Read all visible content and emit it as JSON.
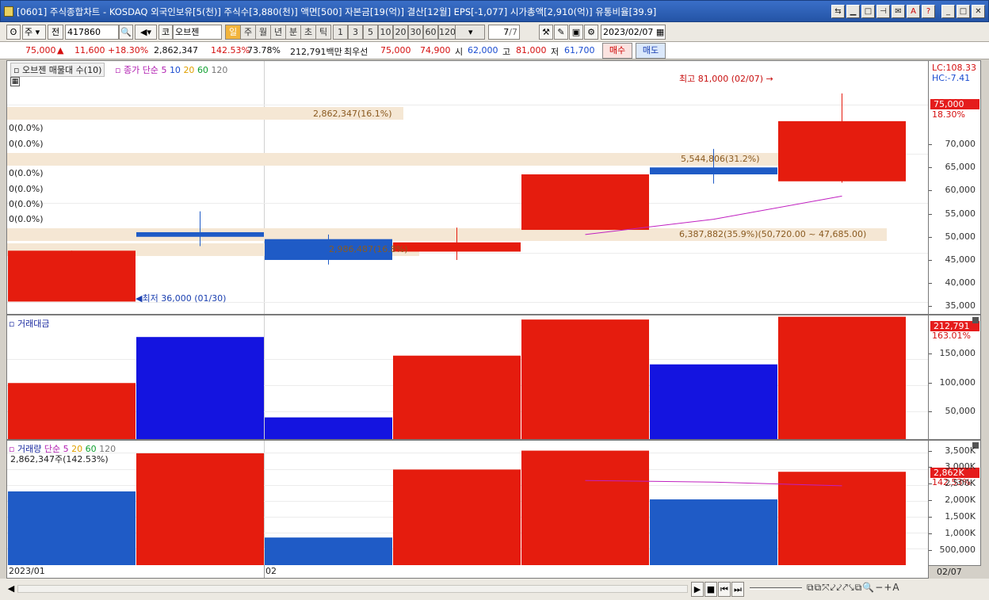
{
  "title": "[0601] 주식종합차트 - KOSDAQ 외국인보유[5(천)] 주식수[3,880(천)] 액면[500] 자본금[19(억)] 결산[12월] EPS[-1,077] 시가총액[2,910(억)] 유통비율[39.9]",
  "toolbar": {
    "period_type": "주",
    "prev_label": "전",
    "code": "417860",
    "market_tag": "코",
    "stock_name": "오브젠",
    "periods": [
      "일",
      "주",
      "월",
      "년",
      "분",
      "초",
      "틱"
    ],
    "active_period": "일",
    "intervals": [
      "1",
      "3",
      "5",
      "10",
      "20",
      "30",
      "60",
      "120"
    ],
    "count": "7",
    "count_total": "/7",
    "date": "2023/02/07"
  },
  "quote": {
    "price": "75,000",
    "up_arrow": "▲",
    "change": "11,600",
    "change_pct": "+18.30%",
    "volume": "2,862,347",
    "volume_ratio": "142.53%",
    "turnover_pct": "73.78%",
    "amount": "212,791백만",
    "best_label": "최우선",
    "ask": "75,000",
    "bid": "74,900",
    "open_label": "시",
    "open": "62,000",
    "high_label": "고",
    "high": "81,000",
    "low_label": "저",
    "low": "61,700",
    "buy_label": "매수",
    "sell_label": "매도"
  },
  "price_panel": {
    "legend_name": "오브젠 매물대 수(10)",
    "ma_label": "종가 단순",
    "ma_periods": [
      "5",
      "10",
      "20",
      "60",
      "120"
    ],
    "high_note": "최고 81,000 (02/07)",
    "low_note": "최저 36,000 (01/30)",
    "zero_labels": [
      "0(0.0%)",
      "0(0.0%)",
      "0(0.0%)",
      "0(0.0%)",
      "0(0.0%)",
      "0(0.0%)"
    ],
    "vp_labels": [
      "2,862,347(16.1%)",
      "5,544,806(31.2%)",
      "6,387,882(35.9%)(50,720.00 ~ 47,685.00)",
      "2,986,487(16.8%)"
    ],
    "lc": "LC:108.33",
    "hc": "HC:-7.41",
    "price_badge": "75,000",
    "price_pct": "18.30%",
    "yticks": [
      "70,000",
      "65,000",
      "60,000",
      "55,000",
      "50,000",
      "45,000",
      "40,000",
      "35,000"
    ]
  },
  "amount_panel": {
    "legend": "거래대금",
    "badge": "212,791",
    "pct": "163.01%",
    "yticks": [
      "150,000",
      "100,000",
      "50,000"
    ]
  },
  "volume_panel": {
    "legend": "거래량",
    "ma_label": "단순",
    "ma_periods": [
      "5",
      "20",
      "60",
      "120"
    ],
    "current": "2,862,347주(142.53%)",
    "badge": "2,862K",
    "pct": "142.53%",
    "yticks": [
      "3,500K",
      "3,000K",
      "2,500K",
      "2,000K",
      "1,500K",
      "1,000K",
      "500,000"
    ]
  },
  "xaxis": {
    "labels": [
      "2023/01",
      "02"
    ],
    "right": "02/07"
  },
  "colors": {
    "up": "#e51c0e",
    "down": "#1f5bc6",
    "ma": "#c020c0",
    "vp_band": "#f5e7d4"
  },
  "chart_data": [
    {
      "type": "candlestick",
      "title": "오브젠",
      "ylim": [
        33000,
        88000
      ],
      "candles": [
        {
          "o": 36000,
          "h": 47000,
          "l": 36000,
          "c": 47000,
          "up": true
        },
        {
          "o": 51000,
          "h": 55500,
          "l": 48000,
          "c": 50000,
          "up": false
        },
        {
          "o": 49500,
          "h": 50500,
          "l": 44000,
          "c": 45000,
          "up": false
        },
        {
          "o": 46800,
          "h": 52000,
          "l": 45000,
          "c": 48800,
          "up": true
        },
        {
          "o": 51500,
          "h": 63500,
          "l": 51500,
          "c": 63500,
          "up": true
        },
        {
          "o": 65000,
          "h": 69000,
          "l": 61500,
          "c": 63500,
          "up": false
        },
        {
          "o": 62000,
          "h": 81000,
          "l": 61700,
          "c": 75000,
          "up": true
        }
      ],
      "ma5": [
        null,
        null,
        null,
        null,
        50500,
        53800,
        58800
      ]
    },
    {
      "type": "bar",
      "title": "거래대금",
      "ylim": [
        0,
        215000
      ],
      "values": [
        99000,
        178000,
        40000,
        146000,
        208000,
        131000,
        212791
      ],
      "up": [
        true,
        false,
        false,
        true,
        true,
        false,
        true
      ]
    },
    {
      "type": "bar",
      "title": "거래량",
      "ylim": [
        0,
        3800000
      ],
      "values": [
        2270000,
        3420000,
        880000,
        2930000,
        3500000,
        2030000,
        2862347
      ],
      "up": [
        false,
        true,
        false,
        true,
        true,
        false,
        true
      ],
      "ma5": [
        null,
        null,
        null,
        null,
        2600000,
        2550000,
        2440000
      ]
    }
  ]
}
